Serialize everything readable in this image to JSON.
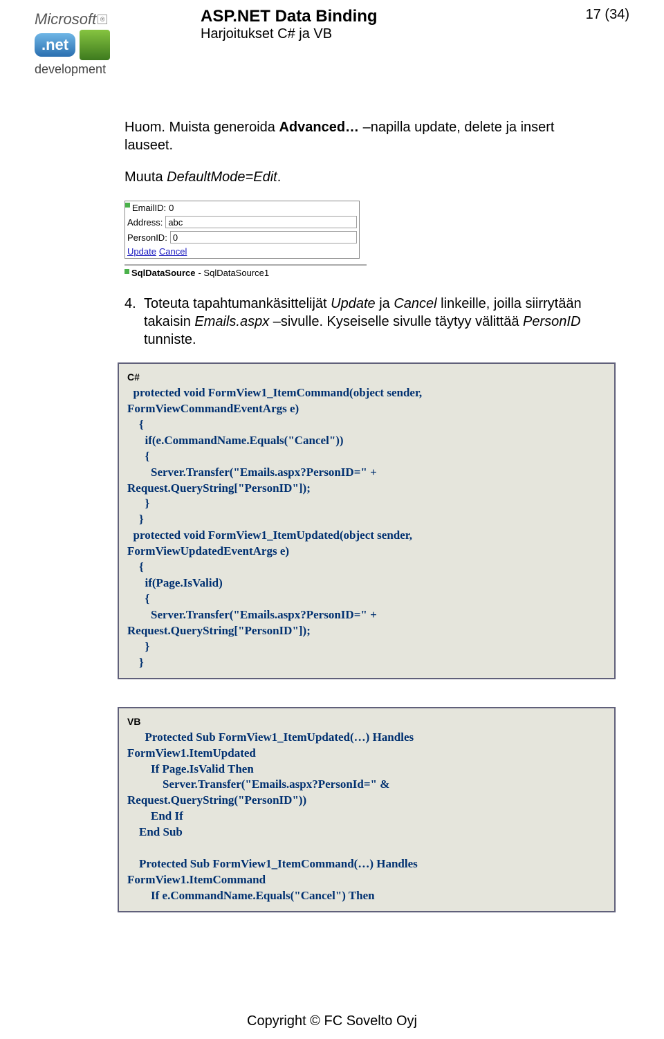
{
  "header": {
    "logo": {
      "top": "Microsoft",
      "reg": "®",
      "net": ".net",
      "bottom": "development"
    },
    "title": "ASP.NET Data Binding",
    "subtitle": "Harjoitukset C# ja VB",
    "page_num": "17 (34)"
  },
  "body": {
    "para1_a": "Huom. Muista generoida ",
    "para1_b": "Advanced…",
    "para1_c": " –napilla update, delete ja insert lauseet.",
    "para2_a": "Muuta ",
    "para2_b": "DefaultMode=Edit",
    "para2_c": ".",
    "form": {
      "row1_label": "EmailID:",
      "row1_value": "0",
      "row2_label": "Address:",
      "row2_value": "abc",
      "row3_label": "PersonID:",
      "row3_value": "0",
      "link_update": "Update",
      "link_cancel": "Cancel",
      "sql_bold": "SqlDataSource",
      "sql_rest": " - SqlDataSource1"
    },
    "step4_num": "4.",
    "step4_a": "Toteuta tapahtumankäsittelijät ",
    "step4_b": "Update",
    "step4_c": " ja ",
    "step4_d": "Cancel",
    "step4_e": " linkeille, joilla siirrytään takaisin ",
    "step4_f": "Emails.aspx",
    "step4_g": " –sivulle. Kyseiselle sivulle täytyy välittää ",
    "step4_h": "PersonID",
    "step4_i": " tunniste.",
    "code_cs_lang": "C#",
    "code_cs": "  protected void FormView1_ItemCommand(object sender,\nFormViewCommandEventArgs e)\n    {\n      if(e.CommandName.Equals(\"Cancel\"))\n      {\n        Server.Transfer(\"Emails.aspx?PersonID=\" +\nRequest.QueryString[\"PersonID\"]);\n      }\n    }\n  protected void FormView1_ItemUpdated(object sender,\nFormViewUpdatedEventArgs e)\n    {\n      if(Page.IsValid)\n      {\n        Server.Transfer(\"Emails.aspx?PersonID=\" +\nRequest.QueryString[\"PersonID\"]);\n      }\n    }",
    "code_vb_lang": "VB",
    "code_vb": "      Protected Sub FormView1_ItemUpdated(…) Handles\nFormView1.ItemUpdated\n        If Page.IsValid Then\n            Server.Transfer(\"Emails.aspx?PersonId=\" &\nRequest.QueryString(\"PersonID\"))\n        End If\n    End Sub\n\n    Protected Sub FormView1_ItemCommand(…) Handles\nFormView1.ItemCommand\n        If e.CommandName.Equals(\"Cancel\") Then"
  },
  "footer": "Copyright ©  FC Sovelto Oyj"
}
